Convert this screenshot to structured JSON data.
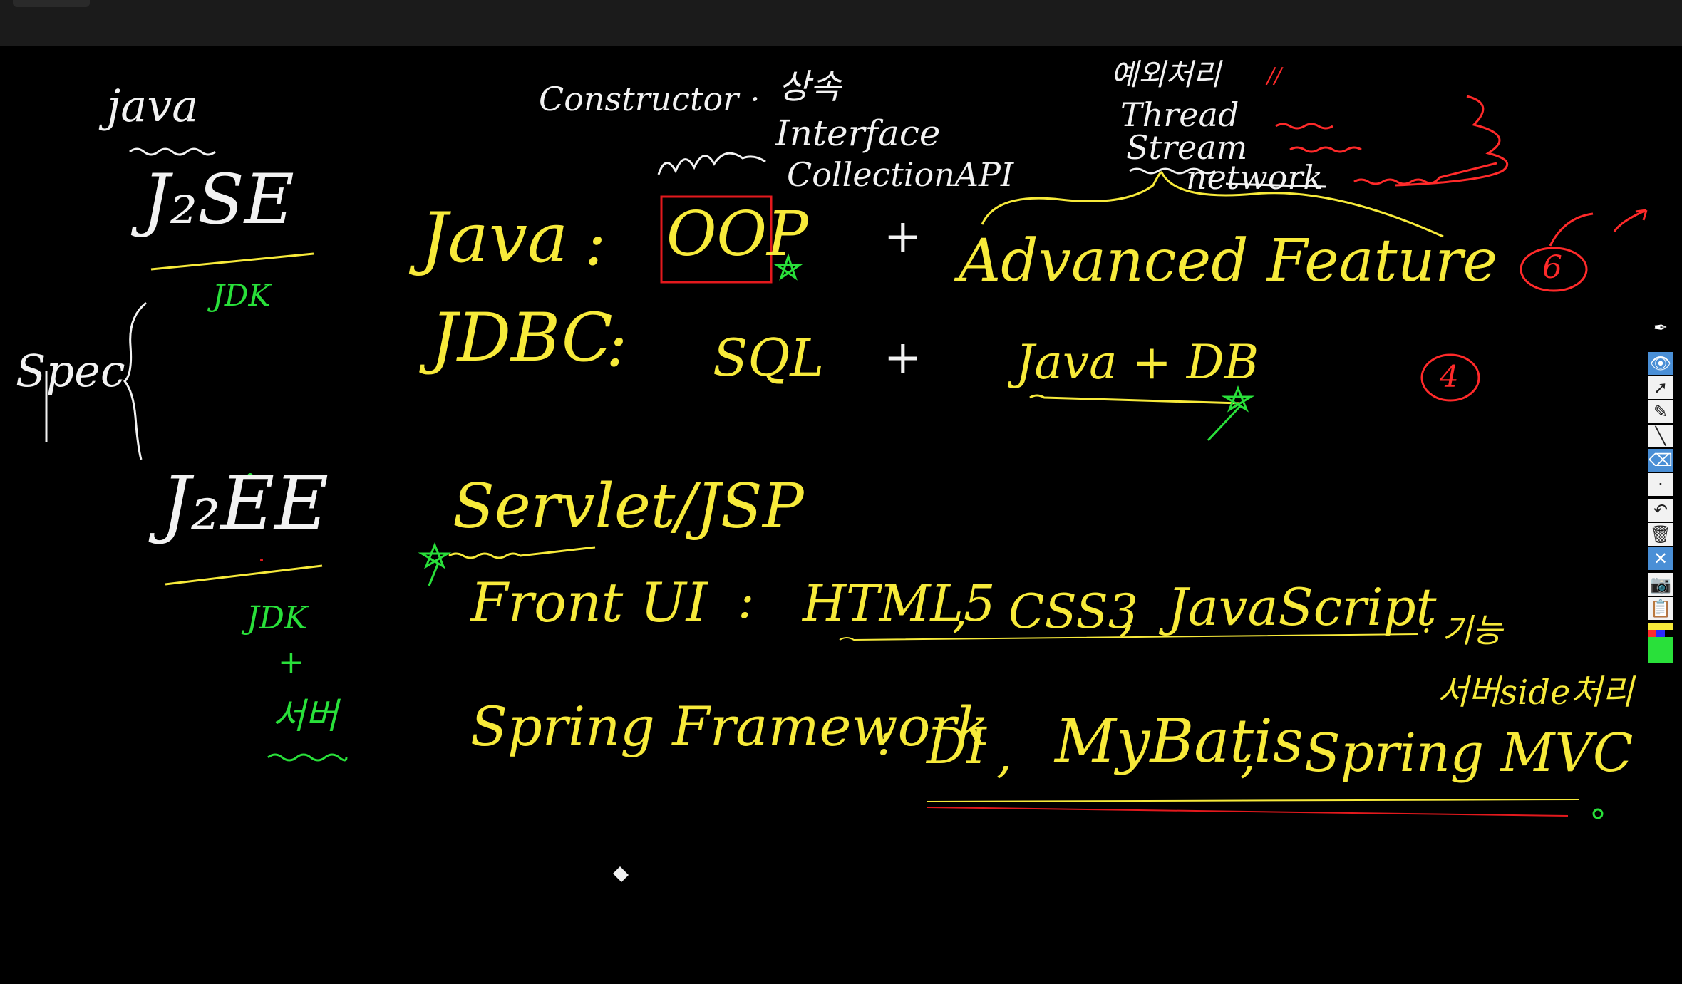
{
  "board": {
    "left": {
      "java": "java",
      "j2se": "J₂SE",
      "jdk1": "JDK",
      "spec": "Spec",
      "j2ee": "J₂EE",
      "jdk2": "JDK",
      "plus": "+",
      "server": "서버"
    },
    "top_notes": {
      "constructor": "Constructor",
      "dot": "·",
      "inheritance": "상속",
      "interface": "Interface",
      "collection": "CollectionAPI",
      "exception": "예외처리",
      "thread": "Thread",
      "stream": "Stream",
      "network": "network"
    },
    "rows": {
      "java_label": "Java",
      "colon": ":",
      "oop": "OOP",
      "plus": "+",
      "advanced": "Advanced  Feature",
      "count6": "6",
      "jdbc_label": "JDBC",
      "sql": "SQL",
      "java_db": "Java + DB",
      "count4": "4",
      "servlet": "Servlet/JSP",
      "front_ui": "Front UI",
      "html5": "HTML5",
      "comma": ",",
      "css3": "CSS3",
      "javascript": "JavaScript",
      "skill": "· 기능",
      "server_side": "서버side처리",
      "spring_fw": "Spring Framework",
      "di": "DI",
      "mybatis": "MyBatis",
      "spring_mvc": "Spring MVC"
    }
  },
  "toolbar": {
    "tools": [
      "pen-icon",
      "eye-icon",
      "pointer-icon",
      "highlighter-icon",
      "line-icon",
      "eraser-icon",
      "dot-icon",
      "undo-icon",
      "trash-icon",
      "clear-icon",
      "camera-icon",
      "clipboard-icon"
    ],
    "colors": [
      "#f7ea3a",
      "#ff2a2a",
      "#2a2aff",
      "#29e03a",
      "#000000"
    ]
  }
}
